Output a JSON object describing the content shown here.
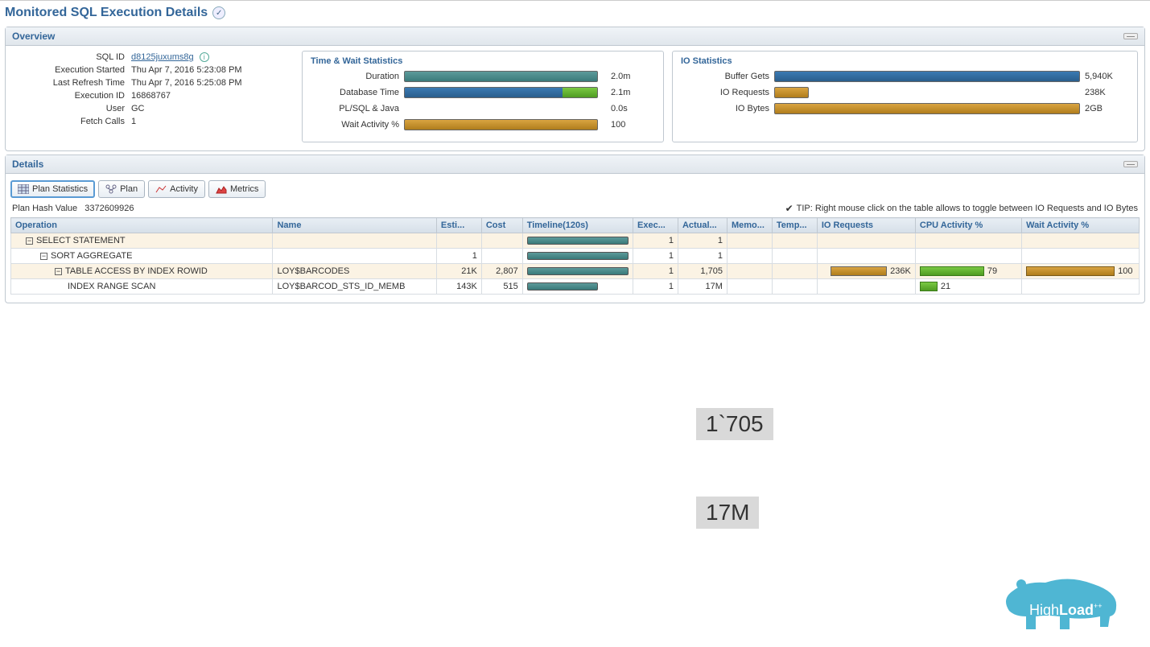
{
  "page_title": "Monitored SQL Execution Details",
  "overview": {
    "panel_title": "Overview",
    "kv": [
      {
        "label": "SQL ID",
        "value": "d8125juxums8g",
        "is_sql_id": true
      },
      {
        "label": "Execution Started",
        "value": "Thu Apr 7, 2016 5:23:08 PM"
      },
      {
        "label": "Last Refresh Time",
        "value": "Thu Apr 7, 2016 5:25:08 PM"
      },
      {
        "label": "Execution ID",
        "value": "16868767"
      },
      {
        "label": "User",
        "value": "GC"
      },
      {
        "label": "Fetch Calls",
        "value": "1"
      }
    ],
    "time_wait": {
      "title": "Time & Wait Statistics",
      "rows": [
        {
          "label": "Duration",
          "value": "2.0m"
        },
        {
          "label": "Database Time",
          "value": "2.1m"
        },
        {
          "label": "PL/SQL & Java",
          "value": "0.0s"
        },
        {
          "label": "Wait Activity %",
          "value": "100"
        }
      ]
    },
    "io": {
      "title": "IO Statistics",
      "rows": [
        {
          "label": "Buffer Gets",
          "value": "5,940K"
        },
        {
          "label": "IO Requests",
          "value": "238K"
        },
        {
          "label": "IO Bytes",
          "value": "2GB"
        }
      ]
    }
  },
  "details": {
    "panel_title": "Details",
    "tabs": [
      "Plan Statistics",
      "Plan",
      "Activity",
      "Metrics"
    ],
    "plan_hash_label": "Plan Hash Value",
    "plan_hash_value": "3372609926",
    "tip": "TIP: Right mouse click on the table allows to toggle between IO Requests and IO Bytes",
    "columns": [
      "Operation",
      "Name",
      "Esti...",
      "Cost",
      "Timeline(120s)",
      "Exec...",
      "Actual...",
      "Memo...",
      "Temp...",
      "IO Requests",
      "CPU Activity %",
      "Wait Activity %"
    ],
    "rows": [
      {
        "op": "SELECT STATEMENT",
        "name": "",
        "esti": "",
        "cost": "",
        "tl": 100,
        "exec": "1",
        "actual": "1",
        "io": "",
        "cpu": "",
        "wait": ""
      },
      {
        "op": "SORT AGGREGATE",
        "name": "",
        "esti": "1",
        "cost": "",
        "tl": 100,
        "exec": "1",
        "actual": "1",
        "io": "",
        "cpu": "",
        "wait": ""
      },
      {
        "op": "TABLE ACCESS BY INDEX ROWID",
        "name": "LOY$BARCODES",
        "esti": "21K",
        "cost": "2,807",
        "tl": 100,
        "exec": "1",
        "actual": "1,705",
        "io": "236K",
        "cpu": "79",
        "wait": "100"
      },
      {
        "op": "INDEX RANGE SCAN",
        "name": "LOY$BARCOD_STS_ID_MEMB",
        "esti": "143K",
        "cost": "515",
        "tl": 70,
        "exec": "1",
        "actual": "17M",
        "io": "",
        "cpu": "21",
        "wait": ""
      }
    ]
  },
  "overlays": {
    "box1": "1`705",
    "box2": "17M"
  },
  "logo_text_pre": "High",
  "logo_text_bold": "Load",
  "logo_sup": "++"
}
